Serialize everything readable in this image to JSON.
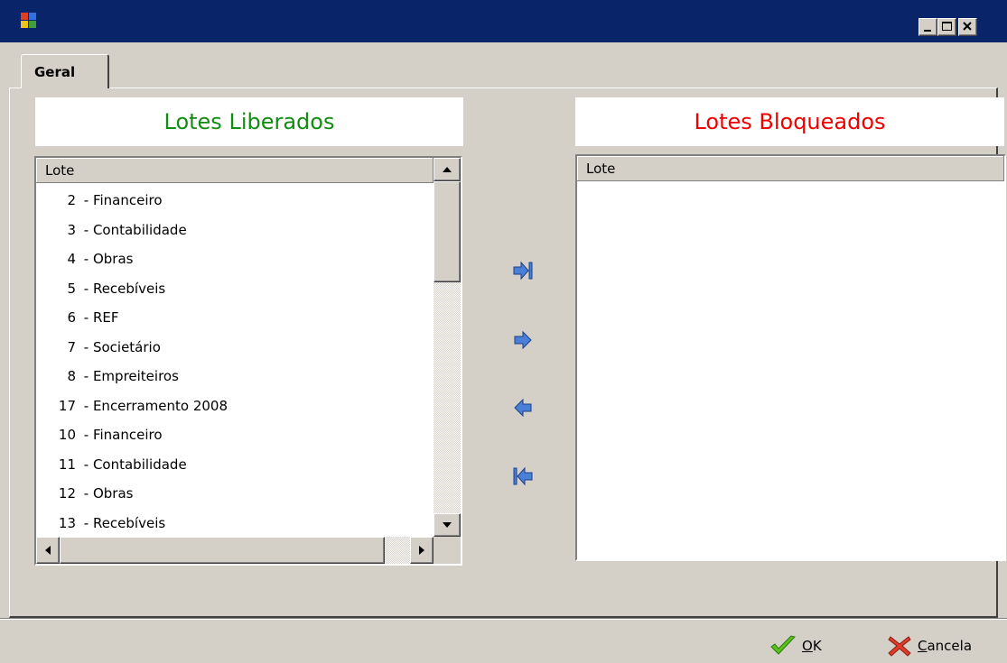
{
  "window": {
    "title": "",
    "controls": [
      "minimize",
      "maximize",
      "close"
    ]
  },
  "tabs": [
    {
      "label": "Geral",
      "active": true
    }
  ],
  "left_panel": {
    "title": "Lotes Liberados",
    "title_color": "#128c12",
    "column_header": "Lote",
    "items": [
      {
        "num": "2",
        "name": "Financeiro"
      },
      {
        "num": "3",
        "name": "Contabilidade"
      },
      {
        "num": "4",
        "name": "Obras"
      },
      {
        "num": "5",
        "name": "Recebíveis"
      },
      {
        "num": "6",
        "name": "REF"
      },
      {
        "num": "7",
        "name": "Societário"
      },
      {
        "num": "8",
        "name": "Empreiteiros"
      },
      {
        "num": "17",
        "name": "Encerramento 2008"
      },
      {
        "num": "10",
        "name": "Financeiro"
      },
      {
        "num": "11",
        "name": "Contabilidade"
      },
      {
        "num": "12",
        "name": "Obras"
      },
      {
        "num": "13",
        "name": "Recebíveis"
      }
    ]
  },
  "right_panel": {
    "title": "Lotes Bloqueados",
    "title_color": "#f00000",
    "column_header": "Lote",
    "items": []
  },
  "transfer_buttons": [
    "move-all-right-icon",
    "move-right-icon",
    "move-left-icon",
    "move-all-left-icon"
  ],
  "footer": {
    "ok_label_prefix": "",
    "ok_mnemonic": "O",
    "ok_rest": "K",
    "cancel_mnemonic": "C",
    "cancel_rest": "ancela"
  }
}
